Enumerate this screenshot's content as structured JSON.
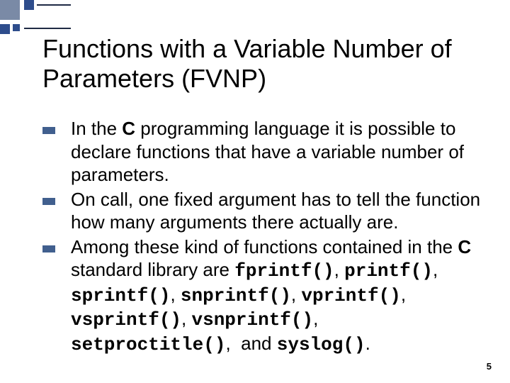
{
  "title": "Functions with a Variable Number of Parameters (FVNP)",
  "bullets": [
    {
      "lead": "In the ",
      "bold1": "C",
      "mid": " programming language it is possible to declare functions that have a variable number of parameters.",
      "funcs": [],
      "tail": ""
    },
    {
      "lead": "On call, one fixed argument has to tell the function how many arguments there actually are.",
      "bold1": "",
      "mid": "",
      "funcs": [],
      "tail": ""
    },
    {
      "lead": "Among these kind of functions contained in the ",
      "bold1": "C",
      "mid": " standard library are ",
      "funcs": [
        "fprintf()",
        "printf()",
        "sprintf()",
        "snprintf()",
        "vprintf()",
        "vsprintf()",
        "vsnprintf()",
        "setproctitle()"
      ],
      "tail_and": "and",
      "last_func": "syslog()",
      "tail_period": "."
    }
  ],
  "pagenum": "5"
}
